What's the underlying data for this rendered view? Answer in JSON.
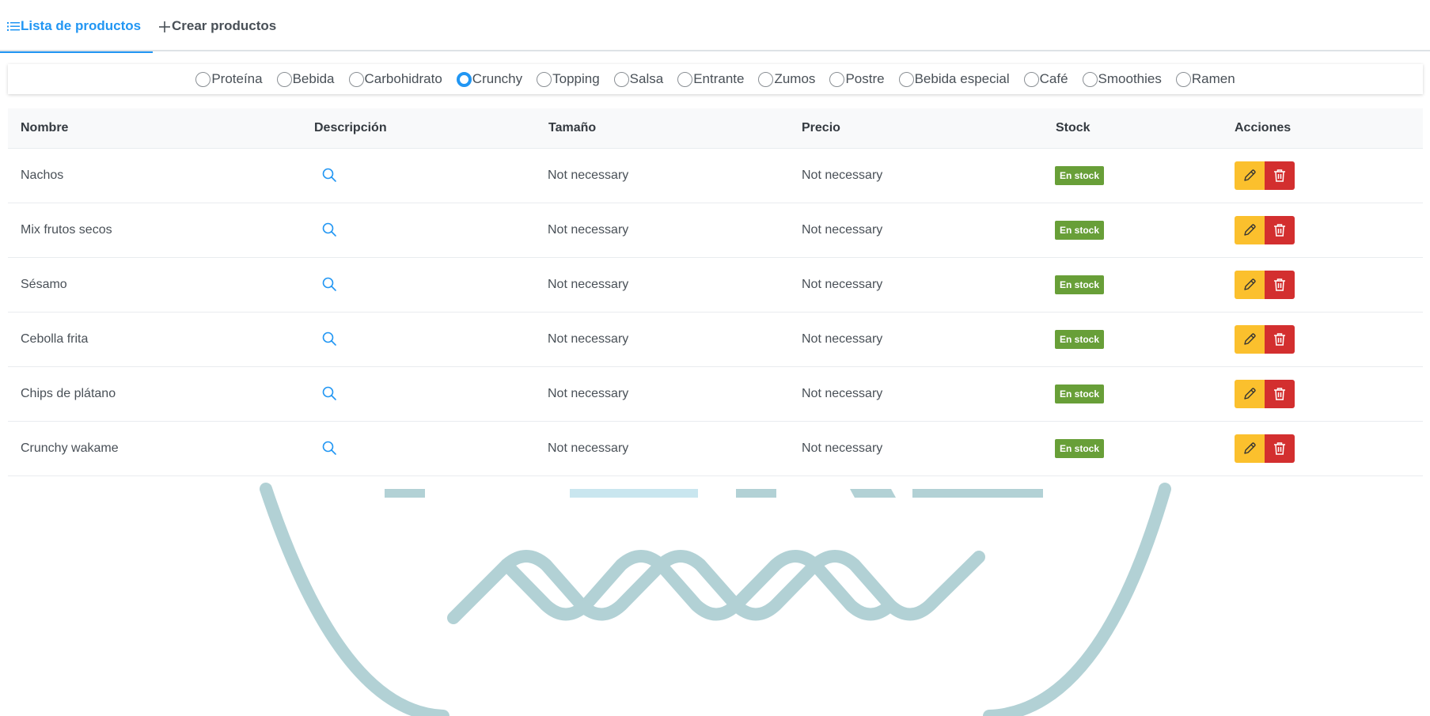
{
  "tabs": [
    {
      "label": "Lista de productos",
      "active": true
    },
    {
      "label": "Crear productos",
      "active": false
    }
  ],
  "filters": {
    "selected": "Crunchy",
    "options": [
      "Proteína",
      "Bebida",
      "Carbohidrato",
      "Crunchy",
      "Topping",
      "Salsa",
      "Entrante",
      "Zumos",
      "Postre",
      "Bebida especial",
      "Café",
      "Smoothies",
      "Ramen"
    ]
  },
  "table": {
    "headers": {
      "name": "Nombre",
      "description": "Descripción",
      "size": "Tamaño",
      "price": "Precio",
      "stock": "Stock",
      "actions": "Acciones"
    },
    "rows": [
      {
        "name": "Nachos",
        "size": "Not necessary",
        "price": "Not necessary",
        "stock": "En stock"
      },
      {
        "name": "Mix frutos secos",
        "size": "Not necessary",
        "price": "Not necessary",
        "stock": "En stock"
      },
      {
        "name": "Sésamo",
        "size": "Not necessary",
        "price": "Not necessary",
        "stock": "En stock"
      },
      {
        "name": "Cebolla frita",
        "size": "Not necessary",
        "price": "Not necessary",
        "stock": "En stock"
      },
      {
        "name": "Chips de plátano",
        "size": "Not necessary",
        "price": "Not necessary",
        "stock": "En stock"
      },
      {
        "name": "Crunchy wakame",
        "size": "Not necessary",
        "price": "Not necessary",
        "stock": "En stock"
      }
    ]
  },
  "icons": {
    "list_tab": "list-icon",
    "create_tab": "plus-icon",
    "description": "search-icon",
    "edit": "pencil-icon",
    "delete": "trash-icon"
  },
  "colors": {
    "primary": "#2196f3",
    "stock_badge": "#689f38",
    "edit_button": "#fbc02d",
    "delete_button": "#d32f2f",
    "watermark": "#b2d1d5"
  }
}
